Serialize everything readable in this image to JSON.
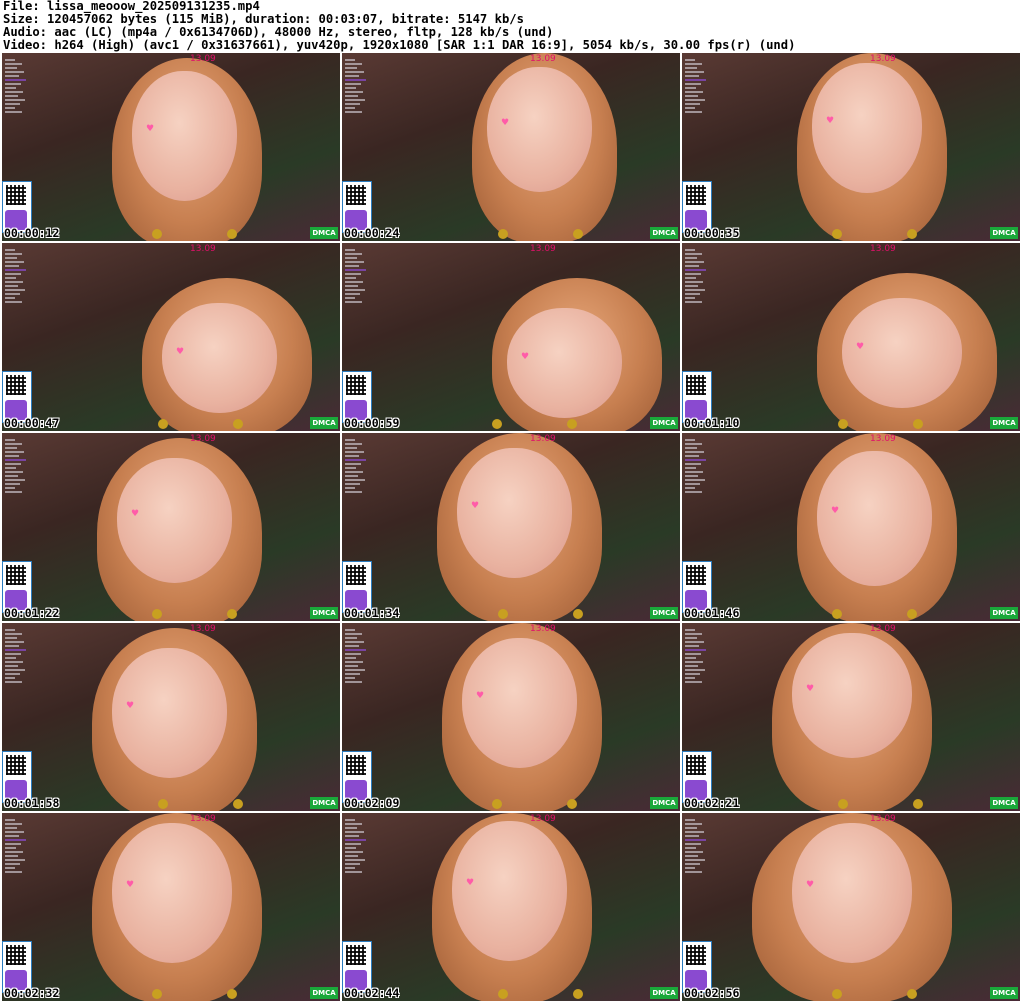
{
  "header": {
    "file": "File: lissa_meooow_202509131235.mp4",
    "size": "Size: 120457062 bytes (115 MiB), duration: 00:03:07, bitrate: 5147 kb/s",
    "audio": "Audio: aac (LC) (mp4a / 0x6134706D), 48000 Hz, stereo, fltp, 128 kb/s (und)",
    "video": "Video: h264 (High) (avc1 / 0x31637661), yuv420p, 1920x1080 [SAR 1:1 DAR 16:9], 5054 kb/s, 30.00 fps(r) (und)"
  },
  "overlay_text": "13.09",
  "dmca_label": "DMCA",
  "thumbnails": [
    {
      "time": "00:00:12"
    },
    {
      "time": "00:00:24"
    },
    {
      "time": "00:00:35"
    },
    {
      "time": "00:00:47"
    },
    {
      "time": "00:00:59"
    },
    {
      "time": "00:01:10"
    },
    {
      "time": "00:01:22"
    },
    {
      "time": "00:01:34"
    },
    {
      "time": "00:01:46"
    },
    {
      "time": "00:01:58"
    },
    {
      "time": "00:02:09"
    },
    {
      "time": "00:02:21"
    },
    {
      "time": "00:02:32"
    },
    {
      "time": "00:02:44"
    },
    {
      "time": "00:02:56"
    }
  ],
  "colors": {
    "overlay": "#e0106a",
    "dmca": "#1aa83a",
    "qr_border": "#2a7cc0"
  }
}
